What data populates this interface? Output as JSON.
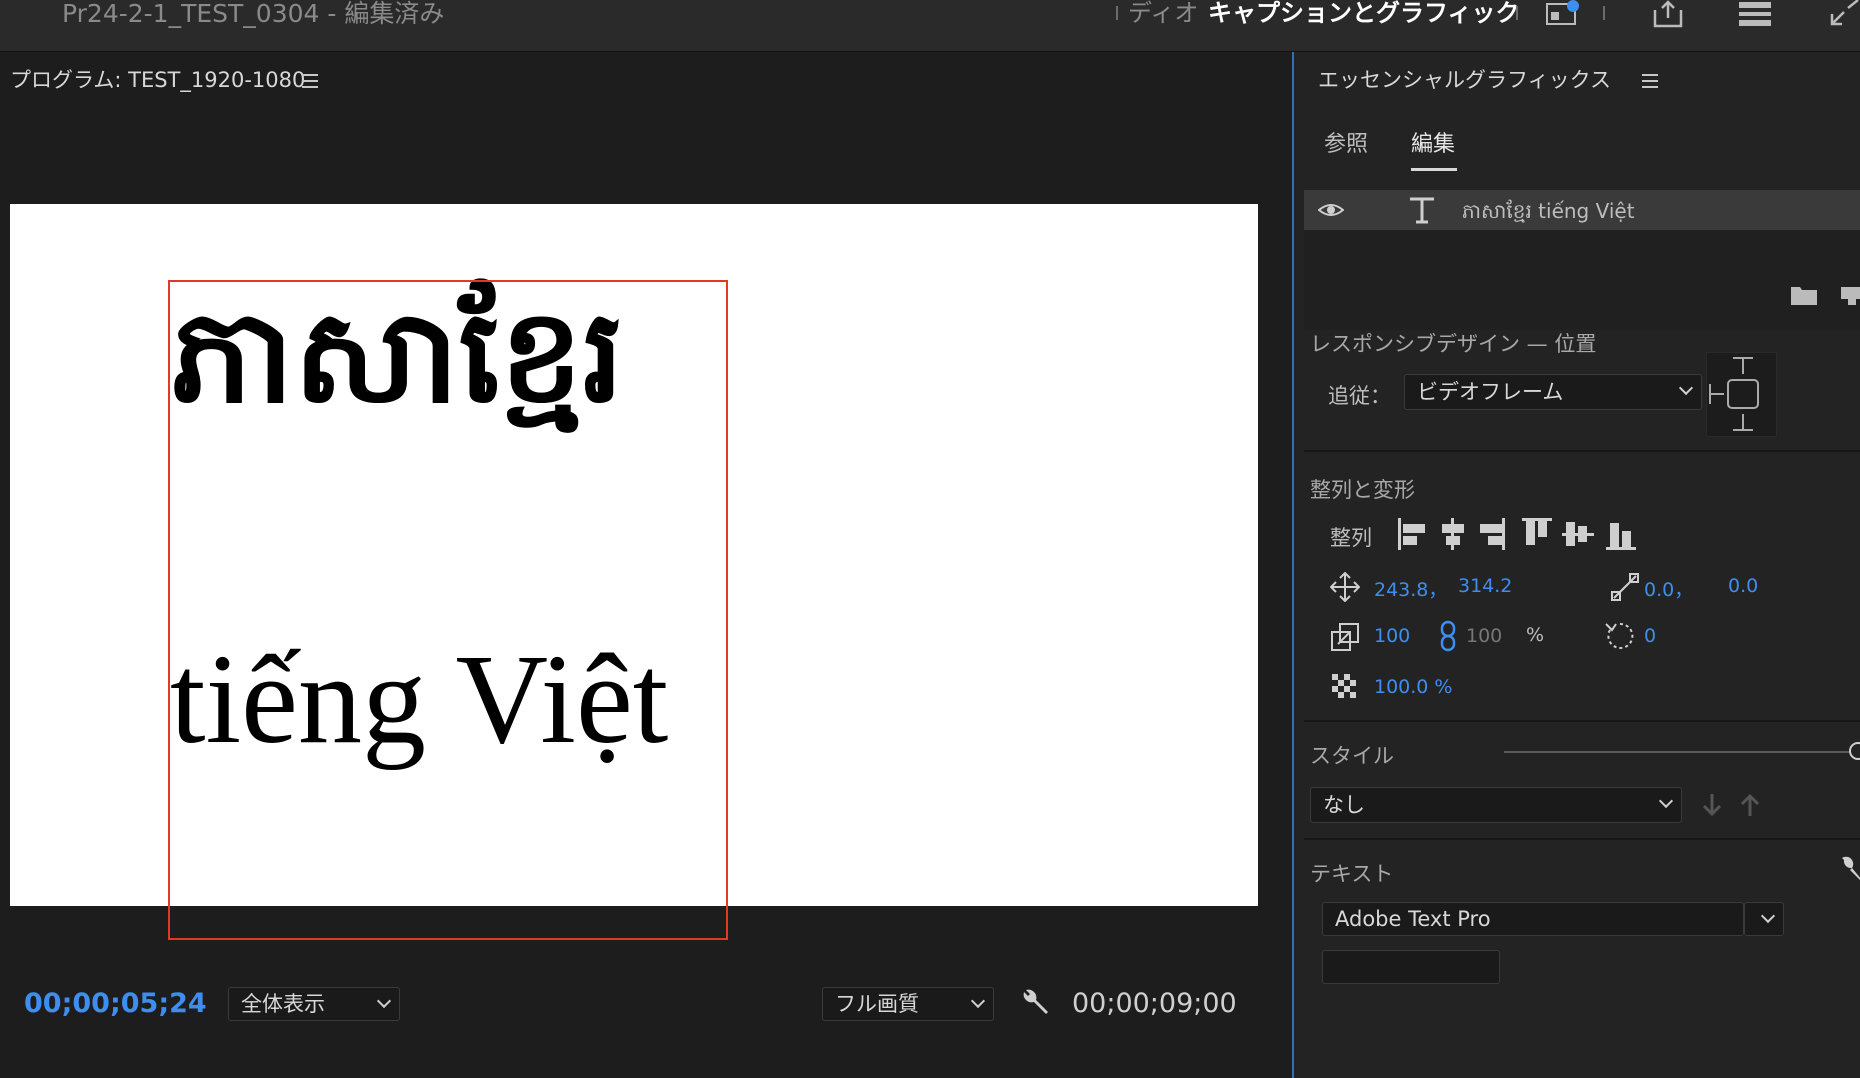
{
  "titlebar": {
    "document_title": "Pr24-2-1_TEST_0304 - 編集済み",
    "workspace_audio": "ディオ",
    "workspace_active": "キャプションとグラフィック"
  },
  "program_monitor": {
    "title": "プログラム: TEST_1920-1080",
    "khmer_text": "ភាសាខ្មែរ",
    "viet_text": "tiếng Việt",
    "current_timecode": "00;00;05;24",
    "zoom": "全体表示",
    "quality": "フル画質",
    "duration_timecode": "00;00;09;00",
    "playhead_fraction": 0.535
  },
  "essential_graphics": {
    "title": "エッセンシャルグラフィックス",
    "tabs": [
      "参照",
      "編集"
    ],
    "active_tab": "編集",
    "layer_name": "ភាសាខ្មែរ tiếng Việt",
    "responsive_title": "レスポンシブデザイン — 位置",
    "follow_label": "追従：",
    "follow_value": "ビデオフレーム",
    "align_title": "整列と変形",
    "align_label": "整列",
    "position_x": "243.8，",
    "position_y": "314.2",
    "anchor_x": "0.0，",
    "anchor_y": "0.0",
    "scale": "100",
    "scale_linked": "100",
    "scale_unit": "%",
    "rotation": "0",
    "opacity": "100.0 %",
    "opacity_fraction": 1.0,
    "style_title": "スタイル",
    "style_value": "なし",
    "text_title": "テキスト",
    "font_value": "Adobe Text Pro"
  },
  "colors": {
    "accent_blue": "#3d8ef0",
    "bbox_red": "#e03a25",
    "panel_bg": "#232323"
  }
}
